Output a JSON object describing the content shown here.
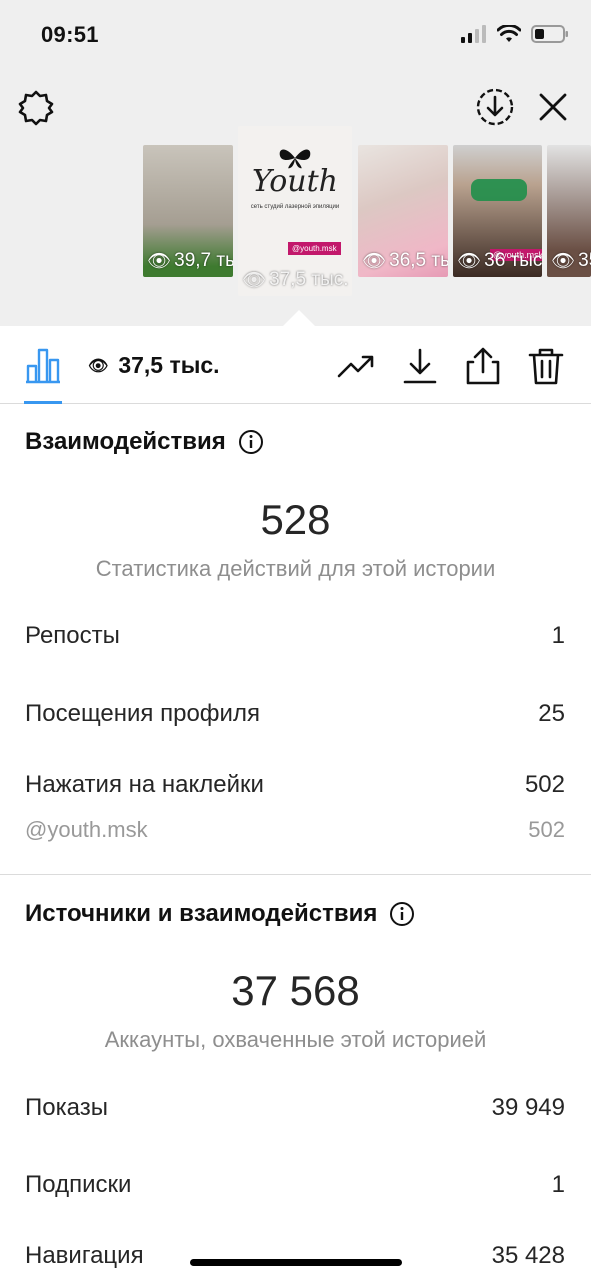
{
  "status_bar": {
    "time": "09:51"
  },
  "thumbnails": [
    {
      "views": "39,7 тыс."
    },
    {
      "views": "37,5 тыс.",
      "logo": "Youth",
      "subtitle": "сеть студий лазерной эпиляции",
      "tag": "@youth.msk"
    },
    {
      "views": "36,5 тыс."
    },
    {
      "views": "36 тыс.",
      "tag": "@youth.msk"
    },
    {
      "views": "35"
    }
  ],
  "toolbar": {
    "reach": "37,5 тыс."
  },
  "interactions": {
    "title": "Взаимодействия",
    "total": "528",
    "caption": "Статистика действий для этой истории",
    "rows": [
      {
        "label": "Репосты",
        "value": "1"
      },
      {
        "label": "Посещения профиля",
        "value": "25"
      },
      {
        "label": "Нажатия на наклейки",
        "value": "502"
      }
    ],
    "sub_row": {
      "label": "@youth.msk",
      "value": "502"
    }
  },
  "discovery": {
    "title": "Источники и взаимодействия",
    "total": "37 568",
    "caption": "Аккаунты, охваченные этой историей",
    "rows": [
      {
        "label": "Показы",
        "value": "39 949"
      },
      {
        "label": "Подписки",
        "value": "1"
      },
      {
        "label": "Навигация",
        "value": "35 428"
      }
    ]
  },
  "colors": {
    "accent": "#3897f0",
    "tag": "#c2186b",
    "top_background": "#efefef"
  }
}
